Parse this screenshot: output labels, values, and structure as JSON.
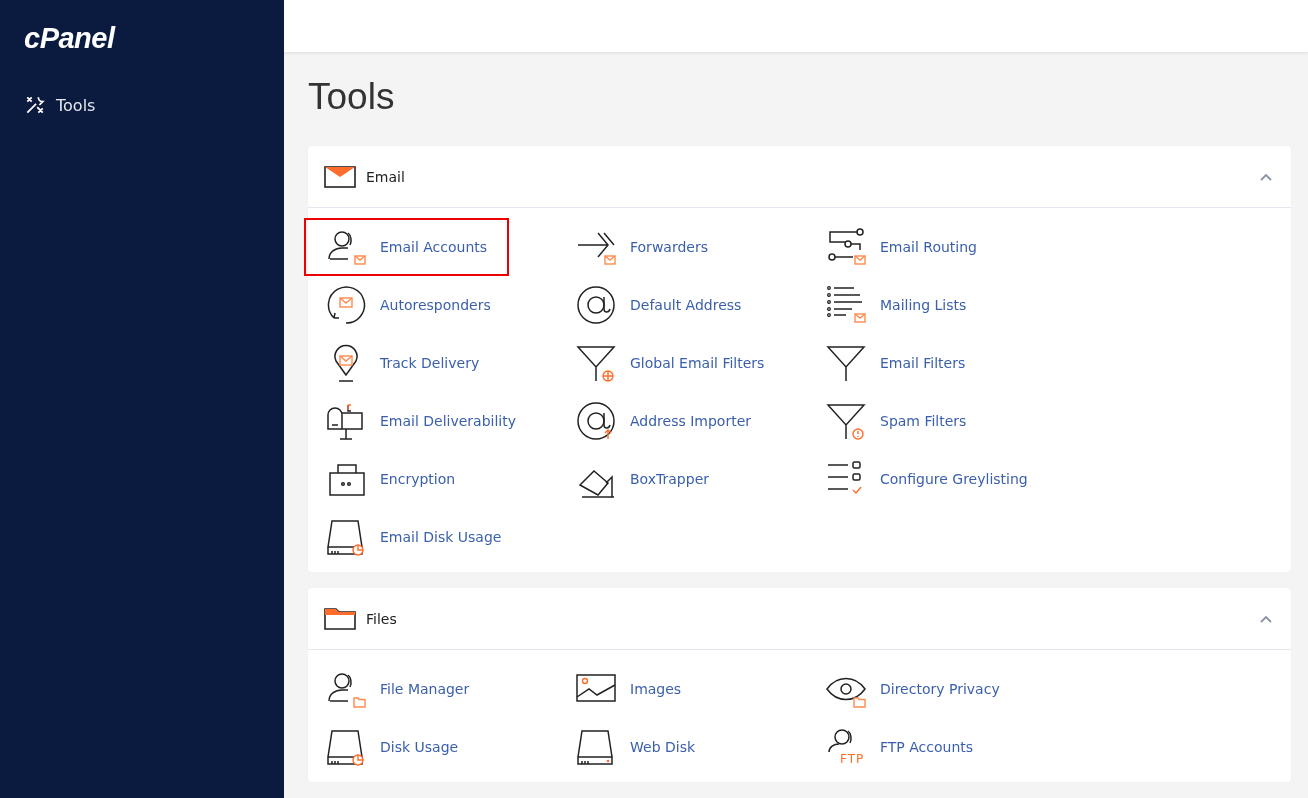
{
  "sidebar": {
    "logo": "cPanel",
    "items": [
      {
        "label": "Tools",
        "selected": false
      }
    ]
  },
  "page_title": "Tools",
  "sections": [
    {
      "title": "Email",
      "kind": "envelope",
      "expanded": true,
      "items": [
        {
          "label": "Email Accounts",
          "kind": "person-mail",
          "highlighted": true
        },
        {
          "label": "Forwarders",
          "kind": "forward",
          "highlighted": false
        },
        {
          "label": "Email Routing",
          "kind": "routing",
          "highlighted": false
        },
        {
          "label": "Autoresponders",
          "kind": "autorespond",
          "highlighted": false
        },
        {
          "label": "Default Address",
          "kind": "at",
          "highlighted": false
        },
        {
          "label": "Mailing Lists",
          "kind": "list",
          "highlighted": false
        },
        {
          "label": "Track Delivery",
          "kind": "pin",
          "highlighted": false
        },
        {
          "label": "Global Email Filters",
          "kind": "filter-globe",
          "highlighted": false
        },
        {
          "label": "Email Filters",
          "kind": "filter",
          "highlighted": false
        },
        {
          "label": "Email Deliverability",
          "kind": "mailbox",
          "highlighted": false
        },
        {
          "label": "Address Importer",
          "kind": "at-up",
          "highlighted": false
        },
        {
          "label": "Spam Filters",
          "kind": "filter-alert",
          "highlighted": false
        },
        {
          "label": "Encryption",
          "kind": "case",
          "highlighted": false
        },
        {
          "label": "BoxTrapper",
          "kind": "trap",
          "highlighted": false
        },
        {
          "label": "Configure Greylisting",
          "kind": "checklist",
          "highlighted": false
        },
        {
          "label": "Email Disk Usage",
          "kind": "disk-chart",
          "highlighted": false
        }
      ]
    },
    {
      "title": "Files",
      "kind": "folder",
      "expanded": true,
      "items": [
        {
          "label": "File Manager",
          "kind": "person-folder",
          "highlighted": false
        },
        {
          "label": "Images",
          "kind": "image",
          "highlighted": false
        },
        {
          "label": "Directory Privacy",
          "kind": "eye-folder",
          "highlighted": false
        },
        {
          "label": "Disk Usage",
          "kind": "disk-chart",
          "highlighted": false
        },
        {
          "label": "Web Disk",
          "kind": "disk",
          "highlighted": false
        },
        {
          "label": "FTP Accounts",
          "kind": "person-ftp",
          "icon_text": "FTP",
          "highlighted": false
        }
      ]
    }
  ]
}
